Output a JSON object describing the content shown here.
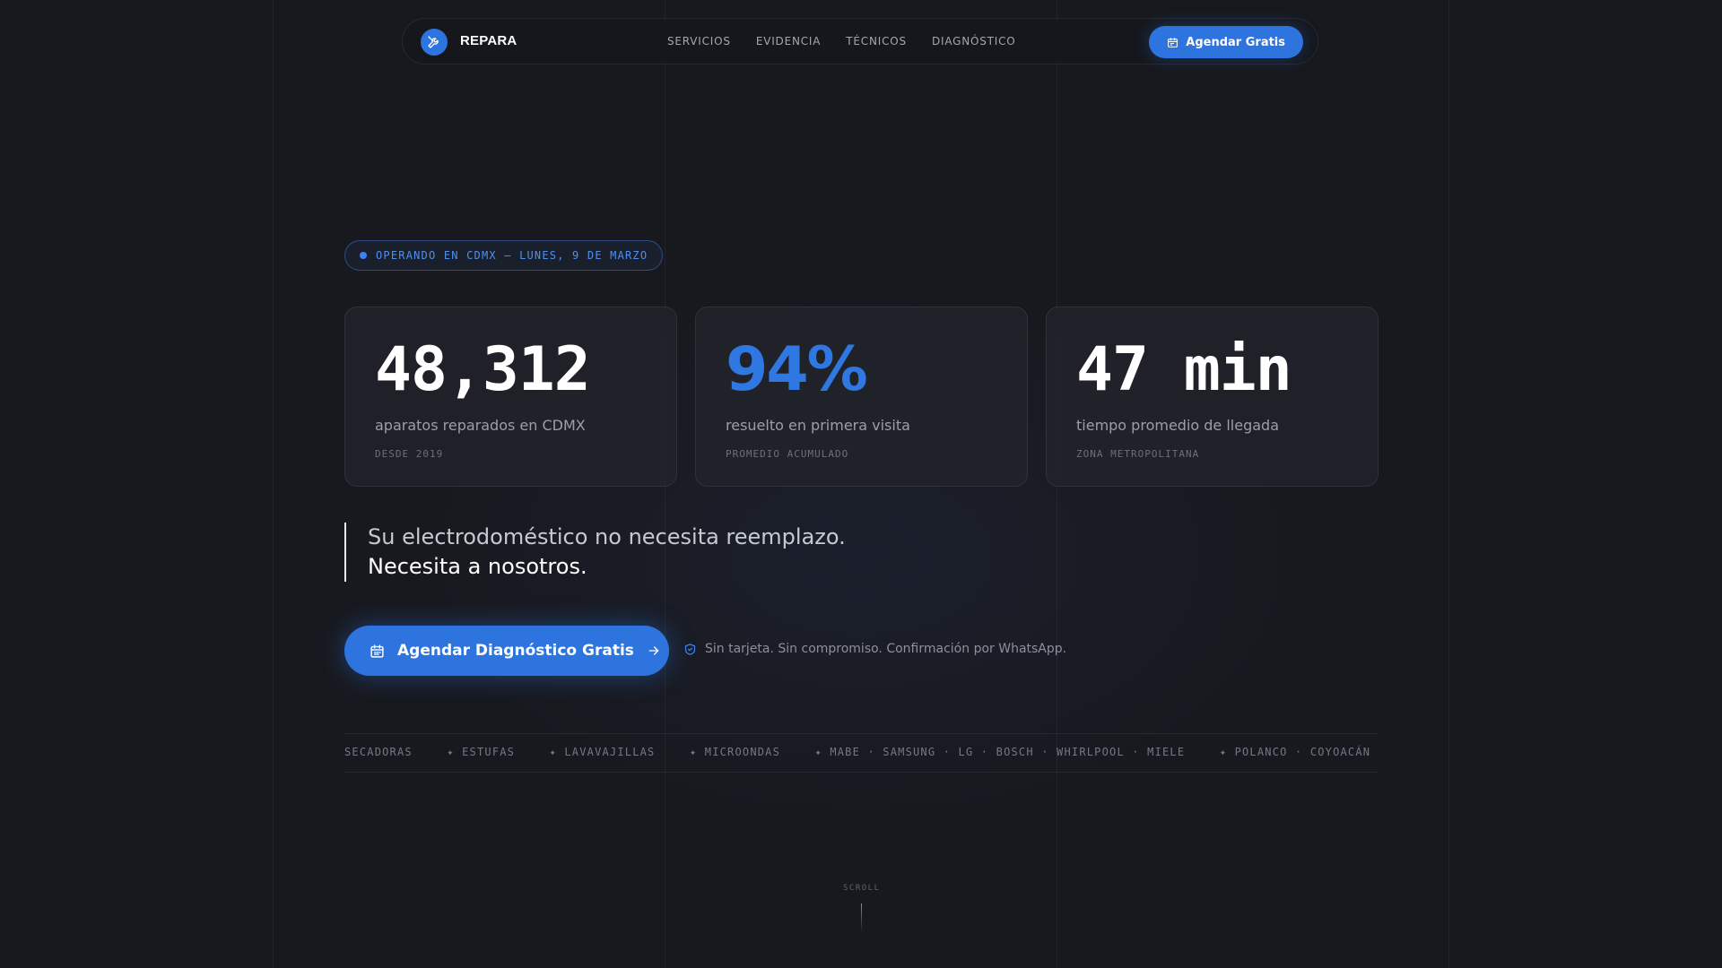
{
  "brand": {
    "name": "REPARA",
    "logo_icon": "tools-icon",
    "accent_color": "#2d74df"
  },
  "nav": {
    "links": [
      "SERVICIOS",
      "EVIDENCIA",
      "TÉCNICOS",
      "DIAGNÓSTICO"
    ],
    "cta_label": "Agendar Gratis",
    "cta_icon": "calendar-icon"
  },
  "hero": {
    "status": "OPERANDO EN CDMX — LUNES, 9 DE MARZO",
    "stats": [
      {
        "value": "48,312",
        "label": "aparatos reparados en CDMX",
        "sub": "DESDE 2019"
      },
      {
        "value": "94%",
        "label": "resuelto en primera visita",
        "sub": "PROMEDIO ACUMULADO"
      },
      {
        "value": "47 min",
        "label": "tiempo promedio de llegada",
        "sub": "ZONA METROPOLITANA"
      }
    ],
    "quote_line1": "Su electrodoméstico no necesita reemplazo.",
    "quote_line2": "Necesita a nosotros.",
    "cta_label": "Agendar Diagnóstico Gratis",
    "cta_icon": "calendar-icon",
    "cta_arrow_icon": "arrow-right-icon",
    "note_icon": "shield-check-icon",
    "note": "Sin tarjeta. Sin compromiso. Confirmación por WhatsApp."
  },
  "ticker": {
    "items": [
      "SECADORAS",
      "✦ ESTUFAS",
      "✦ LAVAVAJILLAS",
      "✦ MICROONDAS",
      "✦ MABE · SAMSUNG · LG · BOSCH · WHIRLPOOL · MIELE",
      "✦ POLANCO · COYOACÁN · R"
    ]
  },
  "scroll": {
    "label": "SCROLL"
  }
}
